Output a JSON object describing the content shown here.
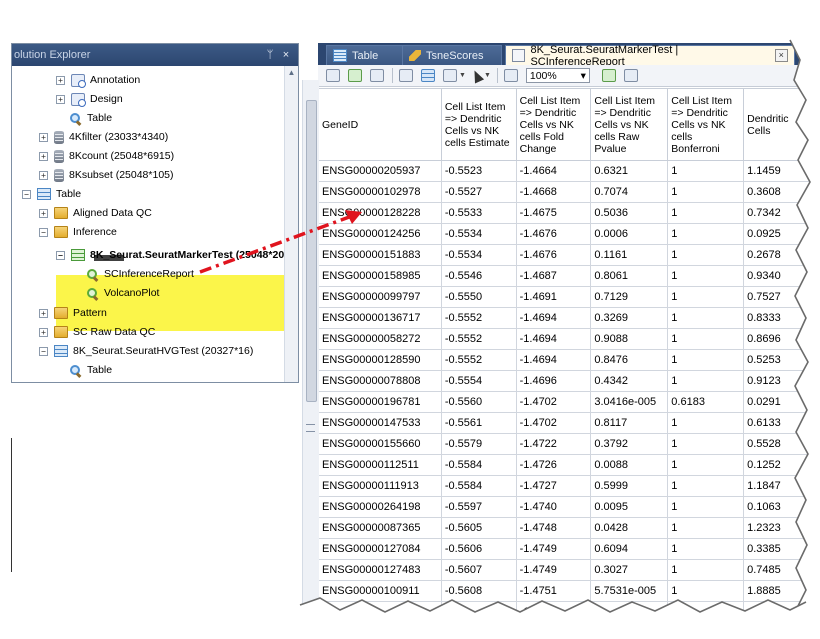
{
  "solution_explorer": {
    "title": "olution Explorer",
    "pin_glyph": "ᛘ",
    "close_glyph": "×",
    "nodes": [
      {
        "label": "Annotation"
      },
      {
        "label": "Design"
      },
      {
        "label": "Table"
      },
      {
        "label": "4Kfilter (23033*4340)"
      },
      {
        "label": "8Kcount (25048*6915)"
      },
      {
        "label": "8Ksubset (25048*105)"
      },
      {
        "label": "Table"
      },
      {
        "label": "Aligned Data QC"
      },
      {
        "label": "Inference"
      },
      {
        "label": "8K_Seurat.SeuratMarkerTest (25048*20"
      },
      {
        "label": "SCInferenceReport"
      },
      {
        "label": "VolcanoPlot"
      },
      {
        "label": "Pattern"
      },
      {
        "label": "SC Raw Data QC"
      },
      {
        "label": "8K_Seurat.SeuratHVGTest (20327*16)"
      },
      {
        "label": "Table"
      }
    ],
    "expander_plus": "+",
    "expander_minus": "−"
  },
  "doc": {
    "tabs": [
      {
        "label": "Table",
        "icon": "table-icon"
      },
      {
        "label": "TsneScores",
        "icon": "pencil-icon"
      },
      {
        "label": "8K_Seurat.SeuratMarkerTest | SCInferenceReport",
        "icon": "report-icon"
      }
    ],
    "tab_close": "×",
    "zoom_value": "100%",
    "zoom_caret": "▾",
    "columns": [
      "GeneID",
      "Cell List Item => Dendritic Cells vs NK cells Estimate",
      "Cell List Item => Dendritic Cells vs NK cells Fold Change",
      "Cell List Item => Dendritic Cells vs NK cells Raw Pvalue",
      "Cell List Item => Dendritic Cells vs NK cells Bonferroni",
      "Dendritic Cells"
    ],
    "rows": [
      [
        "ENSG00000205937",
        "-0.5523",
        "-1.4664",
        "0.6321",
        "1",
        "1.1459"
      ],
      [
        "ENSG00000102978",
        "-0.5527",
        "-1.4668",
        "0.7074",
        "1",
        "0.3608"
      ],
      [
        "ENSG00000128228",
        "-0.5533",
        "-1.4675",
        "0.5036",
        "1",
        "0.7342"
      ],
      [
        "ENSG00000124256",
        "-0.5534",
        "-1.4676",
        "0.0006",
        "1",
        "0.0925"
      ],
      [
        "ENSG00000151883",
        "-0.5534",
        "-1.4676",
        "0.1161",
        "1",
        "0.2678"
      ],
      [
        "ENSG00000158985",
        "-0.5546",
        "-1.4687",
        "0.8061",
        "1",
        "0.9340"
      ],
      [
        "ENSG00000099797",
        "-0.5550",
        "-1.4691",
        "0.7129",
        "1",
        "0.7527"
      ],
      [
        "ENSG00000136717",
        "-0.5552",
        "-1.4694",
        "0.3269",
        "1",
        "0.8333"
      ],
      [
        "ENSG00000058272",
        "-0.5552",
        "-1.4694",
        "0.9088",
        "1",
        "0.8696"
      ],
      [
        "ENSG00000128590",
        "-0.5552",
        "-1.4694",
        "0.8476",
        "1",
        "0.5253"
      ],
      [
        "ENSG00000078808",
        "-0.5554",
        "-1.4696",
        "0.4342",
        "1",
        "0.9123"
      ],
      [
        "ENSG00000196781",
        "-0.5560",
        "-1.4702",
        "3.0416e-005",
        "0.6183",
        "0.0291"
      ],
      [
        "ENSG00000147533",
        "-0.5561",
        "-1.4702",
        "0.8117",
        "1",
        "0.6133"
      ],
      [
        "ENSG00000155660",
        "-0.5579",
        "-1.4722",
        "0.3792",
        "1",
        "0.5528"
      ],
      [
        "ENSG00000112511",
        "-0.5584",
        "-1.4726",
        "0.0088",
        "1",
        "0.1252"
      ],
      [
        "ENSG00000111913",
        "-0.5584",
        "-1.4727",
        "0.5999",
        "1",
        "1.1847"
      ],
      [
        "ENSG00000264198",
        "-0.5597",
        "-1.4740",
        "0.0095",
        "1",
        "0.1063"
      ],
      [
        "ENSG00000087365",
        "-0.5605",
        "-1.4748",
        "0.0428",
        "1",
        "1.2323"
      ],
      [
        "ENSG00000127084",
        "-0.5606",
        "-1.4749",
        "0.6094",
        "1",
        "0.3385"
      ],
      [
        "ENSG00000127483",
        "-0.5607",
        "-1.4749",
        "0.3027",
        "1",
        "0.7485"
      ],
      [
        "ENSG00000100911",
        "-0.5608",
        "-1.4751",
        "5.7531e-005",
        "1",
        "1.8885"
      ],
      [
        "",
        "",
        "-1.4751",
        "",
        "",
        ""
      ]
    ]
  },
  "colors": {
    "highlight": "#fbf54a",
    "arrow": "#e0141e",
    "title_bar": "#2c4670"
  }
}
